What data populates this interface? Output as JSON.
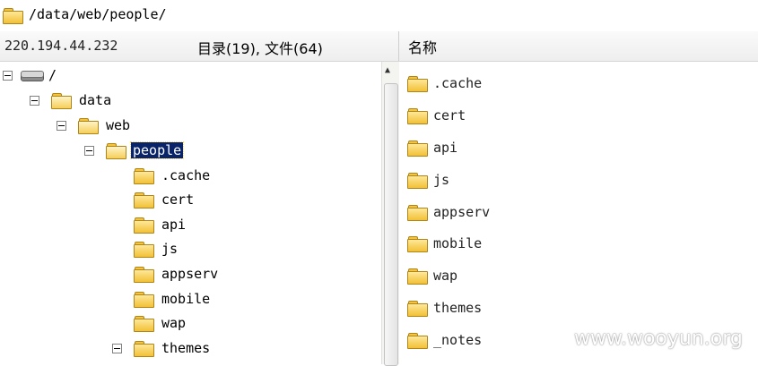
{
  "address_bar": {
    "path": "/data/web/people/",
    "icon": "folder-icon"
  },
  "header": {
    "host": "220.194.44.232",
    "counts": "目录(19), 文件(64)",
    "name_column": "名称"
  },
  "tree": {
    "root": "/",
    "data": "data",
    "web": "web",
    "people": "people",
    "children": [
      ".cache",
      "cert",
      "api",
      "js",
      "appserv",
      "mobile",
      "wap",
      "themes"
    ]
  },
  "list": {
    "items": [
      ".cache",
      "cert",
      "api",
      "js",
      "appserv",
      "mobile",
      "wap",
      "themes",
      "_notes"
    ]
  },
  "watermark": "www.wooyun.org"
}
